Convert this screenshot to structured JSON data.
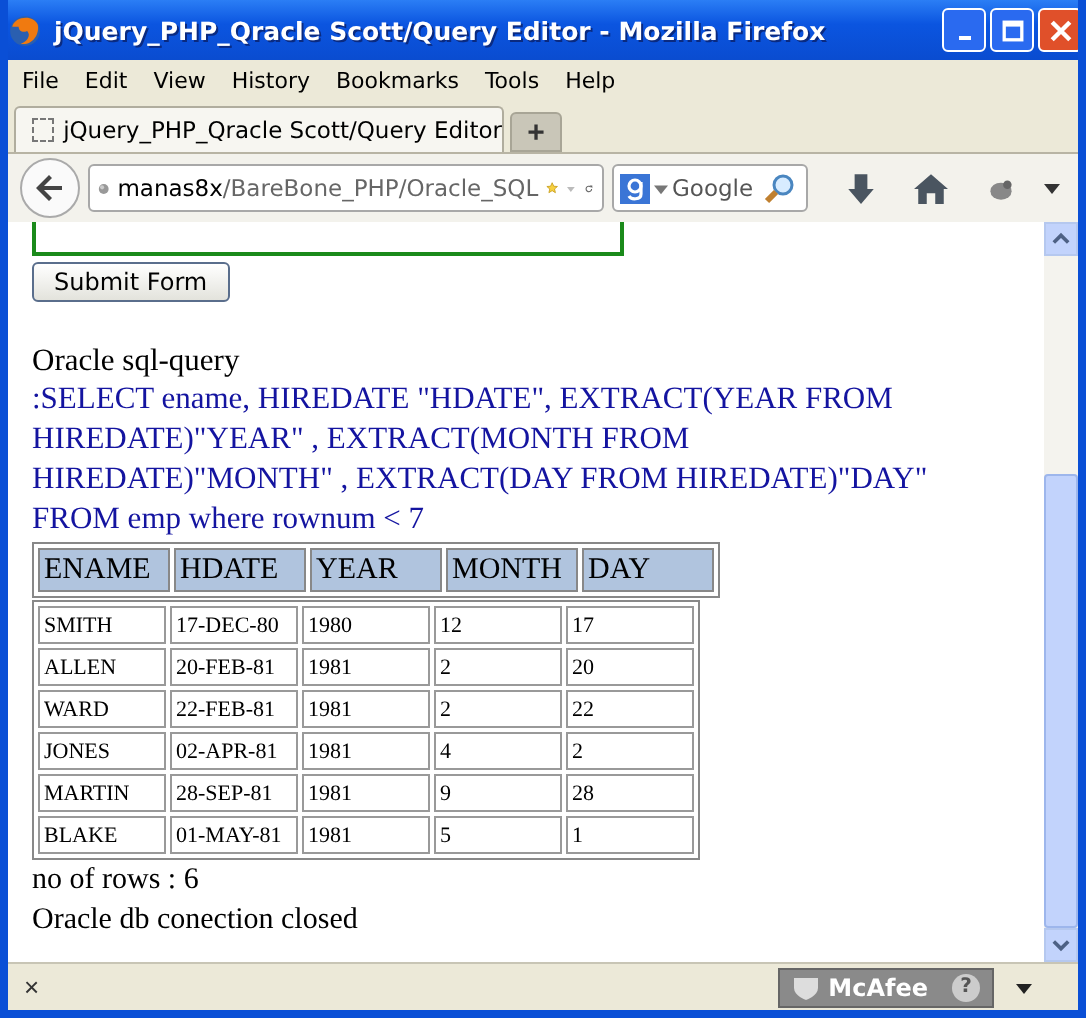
{
  "window": {
    "title": "jQuery_PHP_Qracle Scott/Query Editor - Mozilla Firefox"
  },
  "menu": [
    "File",
    "Edit",
    "View",
    "History",
    "Bookmarks",
    "Tools",
    "Help"
  ],
  "tabs": [
    {
      "label": "jQuery_PHP_Qracle Scott/Query Editor",
      "selected": true
    }
  ],
  "new_tab": "+",
  "address": {
    "host": "manas8x",
    "path": "/BareBone_PHP/Oracle_SQL"
  },
  "search": {
    "placeholder": "Google"
  },
  "page": {
    "submit_button": "Submit Form",
    "heading": "Oracle sql-query",
    "query": ":SELECT ename, HIREDATE \"HDATE\", EXTRACT(YEAR FROM HIREDATE)\"YEAR\" , EXTRACT(MONTH FROM HIREDATE)\"MONTH\" , EXTRACT(DAY FROM HIREDATE)\"DAY\" FROM emp where rownum < 7",
    "table": {
      "columns": [
        "ENAME",
        "HDATE",
        "YEAR",
        "MONTH",
        "DAY"
      ],
      "rows": [
        [
          "SMITH",
          "17-DEC-80",
          "1980",
          "12",
          "17"
        ],
        [
          "ALLEN",
          "20-FEB-81",
          "1981",
          "2",
          "20"
        ],
        [
          "WARD",
          "22-FEB-81",
          "1981",
          "2",
          "22"
        ],
        [
          "JONES",
          "02-APR-81",
          "1981",
          "4",
          "2"
        ],
        [
          "MARTIN",
          "28-SEP-81",
          "1981",
          "9",
          "28"
        ],
        [
          "BLAKE",
          "01-MAY-81",
          "1981",
          "5",
          "1"
        ]
      ]
    },
    "row_count": "no of rows : 6",
    "status": "Oracle db conection closed"
  },
  "status_bar": {
    "close": "×",
    "addon": "McAfee",
    "help": "?"
  }
}
